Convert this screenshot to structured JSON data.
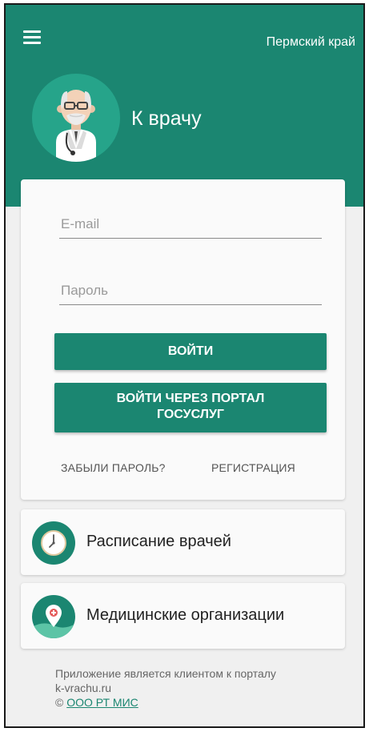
{
  "header": {
    "region": "Пермский край",
    "app_title": "К врачу"
  },
  "login": {
    "email_placeholder": "E-mail",
    "password_placeholder": "Пароль",
    "login_button": "ВОЙТИ",
    "gosuslugi_line1": "ВОЙТИ ЧЕРЕЗ ПОРТАЛ",
    "gosuslugi_line2": "ГОСУСЛУГ",
    "forgot_password": "ЗАБЫЛИ ПАРОЛЬ?",
    "register": "РЕГИСТРАЦИЯ"
  },
  "menu_items": [
    {
      "label": "Расписание врачей",
      "icon": "clock-icon"
    },
    {
      "label": "Медицинские организации",
      "icon": "location-pin-icon"
    }
  ],
  "footer": {
    "line1": "Приложение является клиентом к порталу",
    "line2": "k-vrachu.ru",
    "copyright": "©",
    "company_link": "ООО РТ МИС"
  },
  "colors": {
    "primary": "#1b8671",
    "primary_light": "#26a48a",
    "background": "#f0f0f0"
  }
}
